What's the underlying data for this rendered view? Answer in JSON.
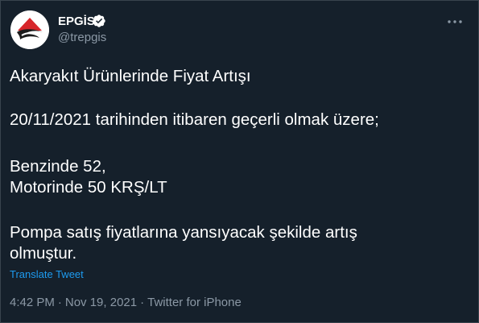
{
  "author": {
    "display_name": "EPGİS",
    "handle": "@trepgis",
    "verified": true,
    "avatar_icon": "epgis-logo-icon"
  },
  "menu_icon": "more-icon",
  "tweet": {
    "lines": [
      "Akaryakıt Ürünlerinde Fiyat Artışı",
      "20/11/2021 tarihinden itibaren geçerli olmak üzere;",
      "Benzinde 52,",
      "Motorinde 50 KRŞ/LT",
      "Pompa satış fiyatlarına yansıyacak şekilde artış",
      "olmuştur."
    ],
    "translate_label": "Translate Tweet"
  },
  "meta": {
    "time": "4:42 PM",
    "date": "Nov 19, 2021",
    "source": "Twitter for iPhone",
    "separator": "·"
  },
  "colors": {
    "background": "#15202b",
    "text": "#ffffff",
    "secondary": "#8b98a5",
    "link": "#1d9bf0",
    "verified": "#1d9bf0",
    "logo_red": "#d7262b"
  }
}
